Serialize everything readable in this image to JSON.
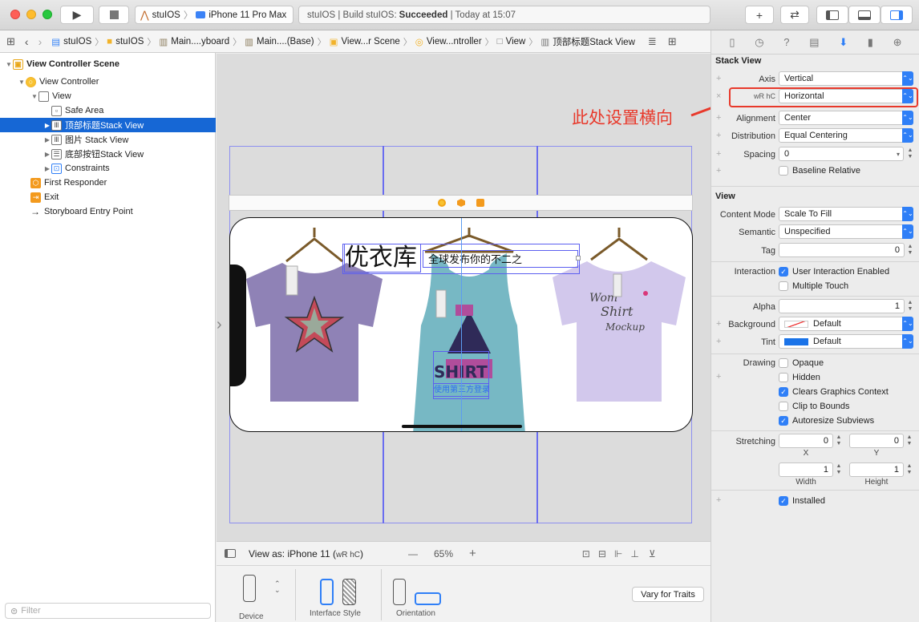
{
  "toolbar": {
    "scheme_target": "stuIOS",
    "scheme_device": "iPhone 11 Pro Max",
    "status_prefix": "stuIOS | Build stuIOS: ",
    "status_result": "Succeeded",
    "status_time": " | Today at 15:07"
  },
  "jumpbar": {
    "crumbs": [
      "stuIOS",
      "stuIOS",
      "Main....yboard",
      "Main....(Base)",
      "View...r Scene",
      "View...ntroller",
      "View",
      "顶部标题Stack View"
    ]
  },
  "navigator": {
    "items": [
      {
        "label": "View Controller Scene"
      },
      {
        "label": "View Controller"
      },
      {
        "label": "View"
      },
      {
        "label": "Safe Area"
      },
      {
        "label": "顶部标题Stack View"
      },
      {
        "label": "图片 Stack View"
      },
      {
        "label": "底部按钮Stack View"
      },
      {
        "label": "Constraints"
      },
      {
        "label": "First Responder"
      },
      {
        "label": "Exit"
      },
      {
        "label": "Storyboard Entry Point"
      }
    ],
    "filter_placeholder": "Filter"
  },
  "canvas": {
    "title_text": "优衣库",
    "subtitle_text": "全球发布你的不二之",
    "button_text": "使用第三方登录",
    "shirt2_logo": "SHIRT"
  },
  "bottombar": {
    "view_as": "View as: iPhone 11 (",
    "size_class": "wR hC",
    "view_as_end": ")",
    "zoom": "65%",
    "minus": "—",
    "plus": "+"
  },
  "devicepanel": {
    "device": "Device",
    "interface_style": "Interface Style",
    "orientation": "Orientation",
    "vary_button": "Vary for Traits"
  },
  "annotation": {
    "text": "此处设置横向",
    "color": "#e8392b"
  },
  "inspector": {
    "section_stack": "Stack View",
    "axis_label": "Axis",
    "axis_value": "Vertical",
    "variation_label": "wR hC",
    "variation_value": "Horizontal",
    "alignment_label": "Alignment",
    "alignment_value": "Center",
    "distribution_label": "Distribution",
    "distribution_value": "Equal Centering",
    "spacing_label": "Spacing",
    "spacing_value": "0",
    "baseline_label": "Baseline Relative",
    "section_view": "View",
    "content_mode_label": "Content Mode",
    "content_mode_value": "Scale To Fill",
    "semantic_label": "Semantic",
    "semantic_value": "Unspecified",
    "tag_label": "Tag",
    "tag_value": "0",
    "interaction_label": "Interaction",
    "user_interaction": "User Interaction Enabled",
    "multiple_touch": "Multiple Touch",
    "alpha_label": "Alpha",
    "alpha_value": "1",
    "background_label": "Background",
    "background_value": "Default",
    "tint_label": "Tint",
    "tint_value": "Default",
    "drawing_label": "Drawing",
    "opaque": "Opaque",
    "hidden": "Hidden",
    "clears_graphics": "Clears Graphics Context",
    "clip_bounds": "Clip to Bounds",
    "autoresize": "Autoresize Subviews",
    "stretching_label": "Stretching",
    "stretch_x": "0",
    "stretch_y": "0",
    "stretch_w": "1",
    "stretch_h": "1",
    "x_label": "X",
    "y_label": "Y",
    "width_label": "Width",
    "height_label": "Height",
    "installed": "Installed",
    "tint_color": "#1a73e8",
    "accent_color": "#2f7ff7"
  }
}
